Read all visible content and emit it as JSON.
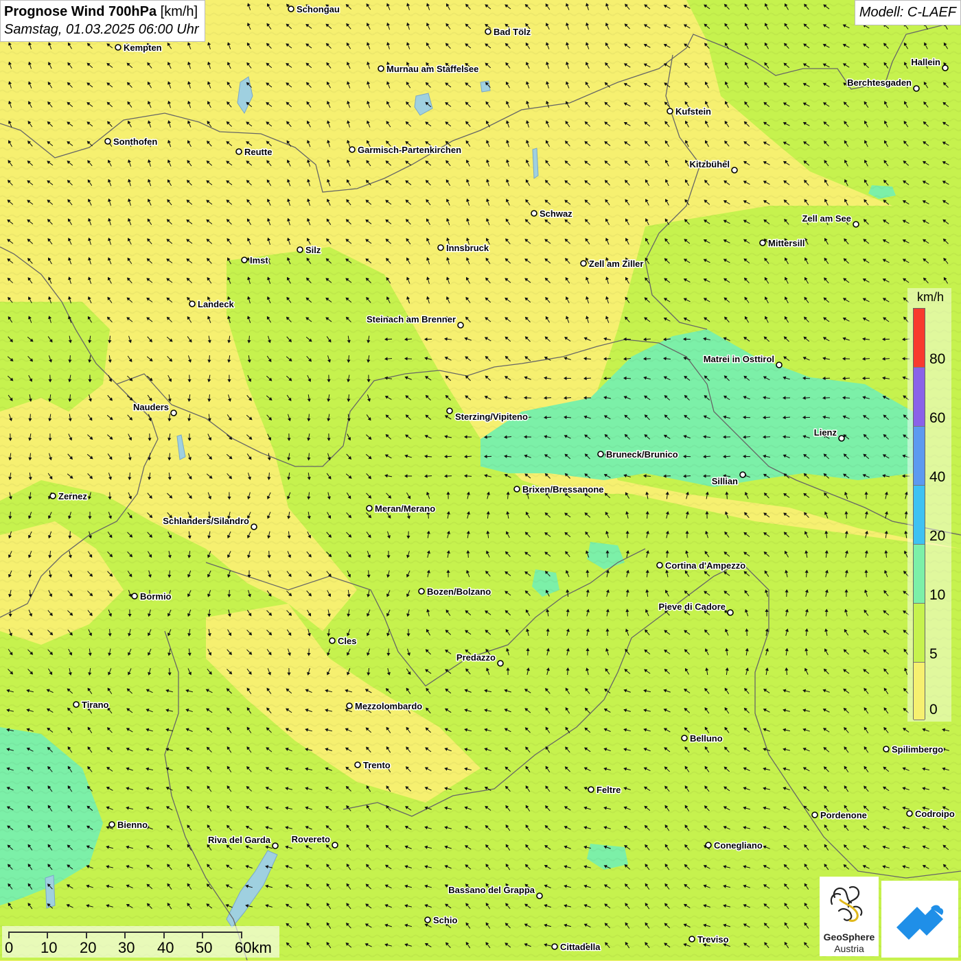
{
  "title": {
    "variable": "Prognose Wind 700hPa",
    "unit": "[km/h]",
    "datetime": "Samstag, 01.03.2025 06:00 Uhr"
  },
  "model": "Modell: C-LAEF",
  "legend": {
    "unit": "km/h",
    "labels": [
      "80",
      "60",
      "40",
      "20",
      "10",
      "5",
      "0"
    ],
    "colors": [
      "#f83a2e",
      "#8a62e8",
      "#5c9af0",
      "#3ec2f2",
      "#7cf0a8",
      "#c6f24e",
      "#f6f070"
    ]
  },
  "scalebar": {
    "labels": [
      "0",
      "10",
      "20",
      "30",
      "40",
      "50",
      "60km"
    ]
  },
  "logo": {
    "line1": "GeoSphere",
    "line2": "Austria"
  },
  "cities": [
    {
      "name": "Schongau"
    },
    {
      "name": "Bad Tölz"
    },
    {
      "name": "Kempten"
    },
    {
      "name": "Murnau am Staffelsee"
    },
    {
      "name": "Hallein"
    },
    {
      "name": "Berchtesgaden"
    },
    {
      "name": "Kufstein"
    },
    {
      "name": "Sonthofen"
    },
    {
      "name": "Reutte"
    },
    {
      "name": "Garmisch-Partenkirchen"
    },
    {
      "name": "Kitzbühel"
    },
    {
      "name": "Schwaz"
    },
    {
      "name": "Zell am See"
    },
    {
      "name": "Mittersill"
    },
    {
      "name": "Silz"
    },
    {
      "name": "Innsbruck"
    },
    {
      "name": "Imst"
    },
    {
      "name": "Zell am Ziller"
    },
    {
      "name": "Landeck"
    },
    {
      "name": "Steinach am Brenner"
    },
    {
      "name": "Matrei in Osttirol"
    },
    {
      "name": "Nauders"
    },
    {
      "name": "Sterzing/Vipiteno"
    },
    {
      "name": "Lienz"
    },
    {
      "name": "Bruneck/Brunico"
    },
    {
      "name": "Sillian"
    },
    {
      "name": "Zernez"
    },
    {
      "name": "Brixen/Bressanone"
    },
    {
      "name": "Meran/Merano"
    },
    {
      "name": "Schlanders/Silandro"
    },
    {
      "name": "Cortina d'Ampezzo"
    },
    {
      "name": "Bormio"
    },
    {
      "name": "Bozen/Bolzano"
    },
    {
      "name": "Pieve di Cadore"
    },
    {
      "name": "Cles"
    },
    {
      "name": "Predazzo"
    },
    {
      "name": "Tirano"
    },
    {
      "name": "Mezzolombardo"
    },
    {
      "name": "Belluno"
    },
    {
      "name": "Spilimbergo"
    },
    {
      "name": "Trento"
    },
    {
      "name": "Feltre"
    },
    {
      "name": "Pordenone"
    },
    {
      "name": "Codroipo"
    },
    {
      "name": "Bienno"
    },
    {
      "name": "Riva del Garda"
    },
    {
      "name": "Rovereto"
    },
    {
      "name": "Conegliano"
    },
    {
      "name": "Bassano del Grappa"
    },
    {
      "name": "Schio"
    },
    {
      "name": "Treviso"
    },
    {
      "name": "Cittadella"
    }
  ]
}
